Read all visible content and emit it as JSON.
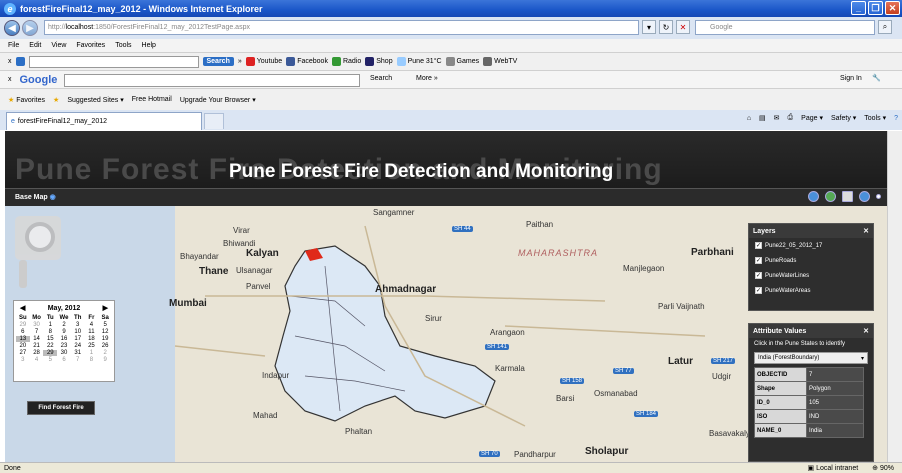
{
  "window": {
    "title": "forestFireFinal12_may_2012 - Windows Internet Explorer"
  },
  "address": {
    "url_prefix": "http://",
    "url_host": "localhost",
    "url_rest": ":1850/ForestFireFinal12_may_2012TestPage.aspx",
    "search_placeholder": "Google"
  },
  "menu": [
    "File",
    "Edit",
    "View",
    "Favorites",
    "Tools",
    "Help"
  ],
  "toolbar": {
    "close": "x",
    "search_btn": "Search",
    "more": "»",
    "links": [
      "Youtube",
      "Facebook",
      "Radio",
      "Shop",
      "Pune 31°C",
      "Games",
      "WebTV"
    ]
  },
  "googlebar": {
    "logo": "Google",
    "search": "Search",
    "more": "More »",
    "signin": "Sign In"
  },
  "favorites": {
    "label": "Favorites",
    "items": [
      "Suggested Sites ▾",
      "Free Hotmail",
      "Upgrade Your Browser ▾"
    ]
  },
  "tab": {
    "label": "forestFireFinal12_may_2012"
  },
  "commands": [
    "Page ▾",
    "Safety ▾",
    "Tools ▾"
  ],
  "app": {
    "ghost_title": "Pune Forest Fire Detection and Monitoring",
    "title": "Pune Forest Fire Detection and Monitoring",
    "basemap": "Base Map"
  },
  "map_labels": {
    "sangamner": "Sangamner",
    "virar": "Virar",
    "bhiwandi": "Bhiwandi",
    "kalyan": "Kalyan",
    "bhayandar": "Bhayandar",
    "thane": "Thane",
    "ulsanagar": "Ulsanagar",
    "panvel": "Panvel",
    "mumbai": "Mumbai",
    "ahmadnagar": "Ahmadnagar",
    "sirur": "Sirur",
    "indapur": "Indapur",
    "mahad": "Mahad",
    "phaltan": "Phaltan",
    "paithan": "Paithan",
    "maharashtra": "MAHARASHTRA",
    "parbhani": "Parbhani",
    "manjlegaon": "Manjlegaon",
    "parli": "Parli Vaijnath",
    "arangaon": "Arangaon",
    "karmala": "Karmala",
    "barsi": "Barsi",
    "osmanabad": "Osmanabad",
    "latur": "Latur",
    "udgir": "Udgir",
    "basavakalyan": "Basavakaly",
    "pandharpur": "Pandharpur",
    "solapur": "Sholapur"
  },
  "highways": [
    "SH 44",
    "SH 141",
    "SH 158",
    "SH 77",
    "SH 217",
    "SH 184",
    "SH 70"
  ],
  "calendar": {
    "month": "May, 2012",
    "dow": [
      "Su",
      "Mo",
      "Tu",
      "We",
      "Th",
      "Fr",
      "Sa"
    ],
    "days": [
      "29",
      "30",
      "1",
      "2",
      "3",
      "4",
      "5",
      "6",
      "7",
      "8",
      "9",
      "10",
      "11",
      "12",
      "13",
      "14",
      "15",
      "16",
      "17",
      "18",
      "19",
      "20",
      "21",
      "22",
      "23",
      "24",
      "25",
      "26",
      "27",
      "28",
      "29",
      "30",
      "31",
      "1",
      "2",
      "3",
      "4",
      "5",
      "6",
      "7",
      "8",
      "9"
    ],
    "find_button": "Find Forest Fire"
  },
  "layers": {
    "title": "Layers",
    "items": [
      "Pune22_05_2012_17",
      "PuneRoads",
      "PuneWaterLines",
      "PuneWaterAreas"
    ]
  },
  "attributes": {
    "title": "Attribute Values",
    "help": "Click in the Pune States to identify",
    "selected": "India (ForestBoundary)",
    "rows": [
      {
        "k": "OBJECTID",
        "v": "7"
      },
      {
        "k": "Shape",
        "v": "Polygon"
      },
      {
        "k": "ID_0",
        "v": "105"
      },
      {
        "k": "ISO",
        "v": "IND"
      },
      {
        "k": "NAME_0",
        "v": "India"
      }
    ]
  },
  "status": {
    "left": "Done",
    "zone": "Local intranet",
    "zoom": "90%"
  }
}
